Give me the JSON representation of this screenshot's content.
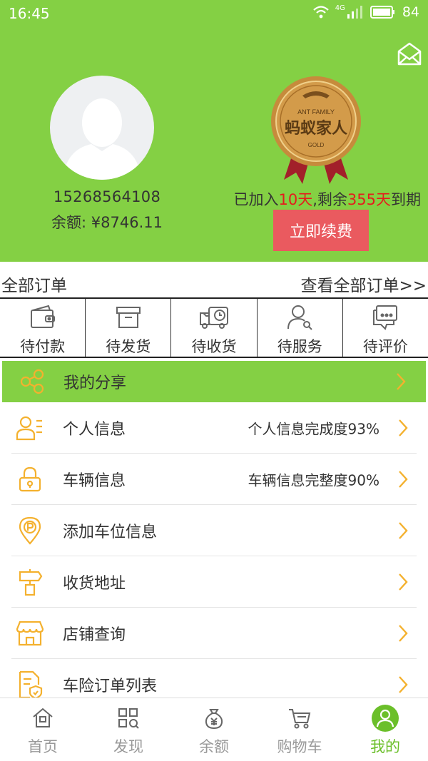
{
  "status_bar": {
    "time": "16:45",
    "network": "4G",
    "battery": "84"
  },
  "profile": {
    "phone": "15268564108",
    "balance": "余额: ¥8746.11",
    "medal_text": {
      "top": "ANT FAMILY",
      "main": "蚂蚁家人",
      "bottom": "GOLD"
    },
    "membership": {
      "prefix": "已加入",
      "joined": "10天",
      "middle": ",剩余",
      "remaining": "355天",
      "suffix": "到期"
    },
    "renew_label": "立即续费"
  },
  "orders": {
    "title": "全部订单",
    "view_all": "查看全部订单>>",
    "tabs": [
      {
        "label": "待付款",
        "icon": "wallet-icon"
      },
      {
        "label": "待发货",
        "icon": "box-icon"
      },
      {
        "label": "待收货",
        "icon": "delivery-truck-icon"
      },
      {
        "label": "待服务",
        "icon": "service-person-icon"
      },
      {
        "label": "待评价",
        "icon": "comment-icon"
      }
    ]
  },
  "menu": {
    "share": {
      "label": "我的分享",
      "icon": "share-icon"
    },
    "items": [
      {
        "label": "个人信息",
        "value": "个人信息完成度93%",
        "icon": "personal-info-icon"
      },
      {
        "label": "车辆信息",
        "value": "车辆信息完整度90%",
        "icon": "car-lock-icon"
      },
      {
        "label": "添加车位信息",
        "value": "",
        "icon": "parking-pin-icon"
      },
      {
        "label": "收货地址",
        "value": "",
        "icon": "signpost-icon"
      },
      {
        "label": "店铺查询",
        "value": "",
        "icon": "store-icon"
      },
      {
        "label": "车险订单列表",
        "value": "",
        "icon": "insurance-doc-icon"
      }
    ]
  },
  "bottom_nav": {
    "items": [
      {
        "label": "首页",
        "icon": "home-icon"
      },
      {
        "label": "发现",
        "icon": "discover-icon"
      },
      {
        "label": "余额",
        "icon": "money-bag-icon"
      },
      {
        "label": "购物车",
        "icon": "cart-icon"
      },
      {
        "label": "我的",
        "icon": "user-icon",
        "active": true
      }
    ]
  },
  "colors": {
    "header_green": "#84d044",
    "accent_orange": "#f4b12e",
    "renew_red": "#ea5a5f",
    "highlight_red": "#e51c1c",
    "nav_active": "#6bbf2a"
  }
}
